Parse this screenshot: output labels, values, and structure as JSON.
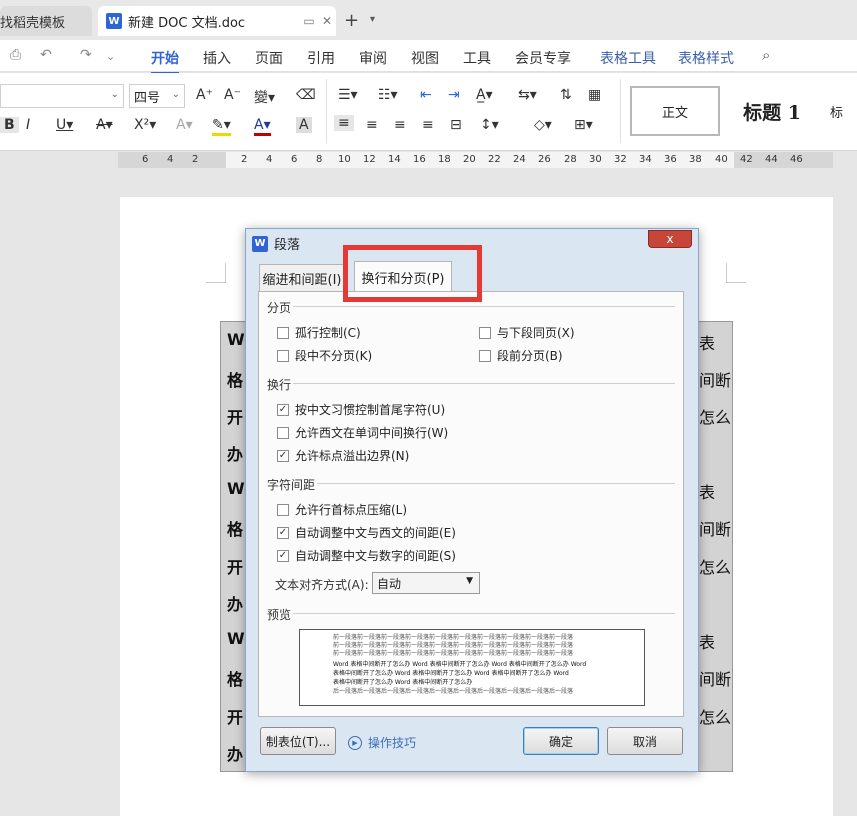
{
  "tabs": {
    "template_tab": "找稻壳模板",
    "doc_tab": "新建 DOC 文档.doc",
    "doc_logo": "W"
  },
  "menu": {
    "items": [
      "开始",
      "插入",
      "页面",
      "引用",
      "审阅",
      "视图",
      "工具",
      "会员专享",
      "表格工具",
      "表格样式"
    ],
    "active": "开始"
  },
  "ribbon": {
    "font_size": "四号",
    "styles": {
      "normal": "正文",
      "heading1": "标题 1",
      "more": "标"
    }
  },
  "ruler": {
    "left_ticks": [
      "6",
      "4",
      "2"
    ],
    "right_ticks": [
      "2",
      "4",
      "6",
      "8",
      "10",
      "12",
      "14",
      "16",
      "18",
      "20",
      "22",
      "24",
      "26",
      "28",
      "30",
      "32",
      "34",
      "36",
      "38",
      "40",
      "42",
      "44",
      "46"
    ]
  },
  "table_text": {
    "left": [
      "Wo",
      "格",
      "开",
      "办",
      "Wo",
      "格",
      "开",
      "办",
      "Wo",
      "格",
      "开",
      "办"
    ],
    "right": [
      "表",
      "间断",
      "怎么",
      "",
      "表",
      "间断",
      "怎么",
      "",
      "表",
      "间断",
      "怎么",
      ""
    ]
  },
  "dialog": {
    "title": "段落",
    "close": "x",
    "tabs": [
      "缩进和间距(I)",
      "换行和分页(P)"
    ],
    "active_tab": "换行和分页(P)",
    "sections": {
      "pagination": "分页",
      "line_break": "换行",
      "char_spacing": "字符间距",
      "preview": "预览"
    },
    "checkboxes": {
      "widow_control": {
        "label": "孤行控制(C)",
        "checked": false
      },
      "keep_with_next": {
        "label": "与下段同页(X)",
        "checked": false
      },
      "keep_lines_together": {
        "label": "段中不分页(K)",
        "checked": false
      },
      "page_break_before": {
        "label": "段前分页(B)",
        "checked": false
      },
      "cjk_line_break": {
        "label": "按中文习惯控制首尾字符(U)",
        "checked": true
      },
      "word_wrap": {
        "label": "允许西文在单词中间换行(W)",
        "checked": false
      },
      "hanging_punct": {
        "label": "允许标点溢出边界(N)",
        "checked": true
      },
      "compress_punct": {
        "label": "允许行首标点压缩(L)",
        "checked": false
      },
      "auto_space_latin": {
        "label": "自动调整中文与西文的间距(E)",
        "checked": true
      },
      "auto_space_number": {
        "label": "自动调整中文与数字的间距(S)",
        "checked": true
      }
    },
    "text_align": {
      "label": "文本对齐方式(A):",
      "value": "自动"
    },
    "preview_text": {
      "prev": "前一段落前一段落前一段落前一段落前一段落前一段落前一段落前一段落前一段落前一段落",
      "current1": "Word 表格中间断开了怎么办 Word 表格中间断开了怎么办 Word 表格中间断开了怎么办 Word",
      "current2": "表格中间断开了怎么办 Word 表格中间断开了怎么办 Word 表格中间断开了怎么办 Word",
      "current3": "表格中间断开了怎么办 Word 表格中间断开了怎么办",
      "next": "后一段落后一段落后一段落后一段落后一段落后一段落后一段落后一段落后一段落后一段落"
    },
    "buttons": {
      "tab_stops": "制表位(T)...",
      "tips": "操作技巧",
      "ok": "确定",
      "cancel": "取消"
    }
  },
  "colors": {
    "accent": "#2f64d6",
    "highlight": "#e53935",
    "dialog_frame": "#dbe6f3"
  }
}
